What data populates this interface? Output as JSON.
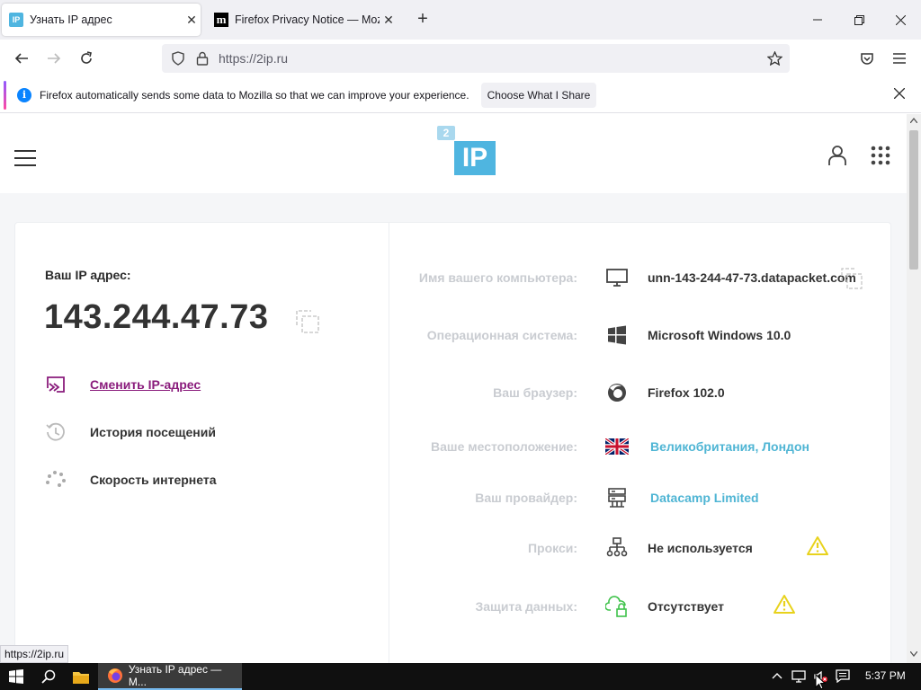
{
  "browser": {
    "tabs": [
      {
        "favicon": "2ip-favicon",
        "title": "Узнать IP адрес",
        "active": true
      },
      {
        "favicon": "mozilla-favicon",
        "title": "Firefox Privacy Notice — Mozilla",
        "active": false
      }
    ],
    "url": "https://2ip.ru",
    "notification": {
      "text": "Firefox automatically sends some data to Mozilla so that we can improve your experience.",
      "button": "Choose What I Share"
    },
    "status_url": "https://2ip.ru"
  },
  "site": {
    "logo_small": "2",
    "logo_big": "IP",
    "ip_label": "Ваш IP адрес:",
    "ip_value": "143.244.47.73",
    "menu": [
      {
        "icon": "swap-ip-icon",
        "label": "Сменить IP-адрес",
        "link": true
      },
      {
        "icon": "history-icon",
        "label": "История посещений",
        "link": false
      },
      {
        "icon": "speed-icon",
        "label": "Скорость интернета",
        "link": false
      }
    ],
    "info": [
      {
        "label": "Имя вашего компьютера:",
        "icon": "monitor-icon",
        "value": "unn-143-244-47-73.datapacket.com",
        "link": false
      },
      {
        "label": "Операционная система:",
        "icon": "windows-icon",
        "value": "Microsoft Windows 10.0",
        "link": false
      },
      {
        "label": "Ваш браузер:",
        "icon": "firefox-icon",
        "value": "Firefox 102.0",
        "link": false
      },
      {
        "label": "Ваше местоположение:",
        "icon": "uk-flag-icon",
        "value": "Великобритания, Лондон",
        "link": true
      },
      {
        "label": "Ваш провайдер:",
        "icon": "server-icon",
        "value": "Datacamp Limited",
        "link": true
      },
      {
        "label": "Прокси:",
        "icon": "network-icon",
        "value": "Не используется",
        "link": false,
        "warning": true
      },
      {
        "label": "Защита данных:",
        "icon": "cloud-lock-icon",
        "value": "Отсутствует",
        "link": false,
        "warning": true
      }
    ],
    "colors": {
      "accent": "#4fb5e0",
      "link_purple": "#8a1c7c",
      "warn": "#e8d21c"
    }
  },
  "taskbar": {
    "app_label": "Узнать IP адрес — M...",
    "time": "5:37 PM"
  }
}
